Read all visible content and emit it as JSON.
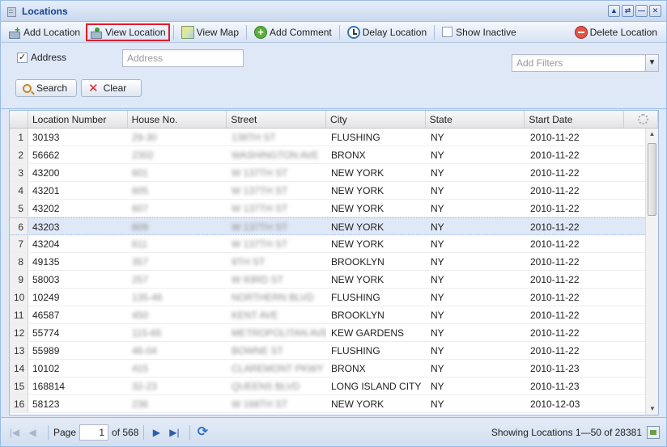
{
  "window": {
    "title": "Locations",
    "tools": [
      "▲",
      "⇄",
      "—",
      "✕"
    ]
  },
  "toolbar": {
    "add_location": "Add Location",
    "view_location": "View Location",
    "view_map": "View Map",
    "add_comment": "Add Comment",
    "delay_location": "Delay Location",
    "show_inactive": "Show Inactive",
    "delete_location": "Delete Location"
  },
  "filters": {
    "address_checkbox_label": "Address",
    "address_checked": true,
    "address_placeholder": "Address",
    "add_filters_placeholder": "Add Filters",
    "search_label": "Search",
    "clear_label": "Clear"
  },
  "grid": {
    "columns": [
      "Location Number",
      "House No.",
      "Street",
      "City",
      "State",
      "Start Date"
    ],
    "selected_row": 6,
    "rows": [
      {
        "n": "1",
        "loc": "30193",
        "house": "29-30",
        "street": "138TH ST",
        "city": "FLUSHING",
        "state": "NY",
        "date": "2010-11-22"
      },
      {
        "n": "2",
        "loc": "56662",
        "house": "2302",
        "street": "WASHINGTON AVE",
        "city": "BRONX",
        "state": "NY",
        "date": "2010-11-22"
      },
      {
        "n": "3",
        "loc": "43200",
        "house": "601",
        "street": "W 137TH ST",
        "city": "NEW YORK",
        "state": "NY",
        "date": "2010-11-22"
      },
      {
        "n": "4",
        "loc": "43201",
        "house": "605",
        "street": "W 137TH ST",
        "city": "NEW YORK",
        "state": "NY",
        "date": "2010-11-22"
      },
      {
        "n": "5",
        "loc": "43202",
        "house": "607",
        "street": "W 137TH ST",
        "city": "NEW YORK",
        "state": "NY",
        "date": "2010-11-22"
      },
      {
        "n": "6",
        "loc": "43203",
        "house": "609",
        "street": "W 137TH ST",
        "city": "NEW YORK",
        "state": "NY",
        "date": "2010-11-22"
      },
      {
        "n": "7",
        "loc": "43204",
        "house": "611",
        "street": "W 137TH ST",
        "city": "NEW YORK",
        "state": "NY",
        "date": "2010-11-22"
      },
      {
        "n": "8",
        "loc": "49135",
        "house": "357",
        "street": "9TH ST",
        "city": "BROOKLYN",
        "state": "NY",
        "date": "2010-11-22"
      },
      {
        "n": "9",
        "loc": "58003",
        "house": "257",
        "street": "W 93RD ST",
        "city": "NEW YORK",
        "state": "NY",
        "date": "2010-11-22"
      },
      {
        "n": "10",
        "loc": "10249",
        "house": "135-46",
        "street": "NORTHERN BLVD",
        "city": "FLUSHING",
        "state": "NY",
        "date": "2010-11-22"
      },
      {
        "n": "11",
        "loc": "46587",
        "house": "450",
        "street": "KENT AVE",
        "city": "BROOKLYN",
        "state": "NY",
        "date": "2010-11-22"
      },
      {
        "n": "12",
        "loc": "55774",
        "house": "115-65",
        "street": "METROPOLITAN AVE",
        "city": "KEW GARDENS",
        "state": "NY",
        "date": "2010-11-22"
      },
      {
        "n": "13",
        "loc": "55989",
        "house": "46-04",
        "street": "BOWNE ST",
        "city": "FLUSHING",
        "state": "NY",
        "date": "2010-11-22"
      },
      {
        "n": "14",
        "loc": "10102",
        "house": "415",
        "street": "CLAREMONT PKWY",
        "city": "BRONX",
        "state": "NY",
        "date": "2010-11-23"
      },
      {
        "n": "15",
        "loc": "168814",
        "house": "32-23",
        "street": "QUEENS BLVD",
        "city": "LONG ISLAND CITY",
        "state": "NY",
        "date": "2010-11-23"
      },
      {
        "n": "16",
        "loc": "58123",
        "house": "236",
        "street": "W 168TH ST",
        "city": "NEW YORK",
        "state": "NY",
        "date": "2010-12-03"
      }
    ]
  },
  "paging": {
    "page_label": "Page",
    "page_value": "1",
    "of_label": "of 568",
    "status": "Showing Locations 1—50 of 28381"
  }
}
